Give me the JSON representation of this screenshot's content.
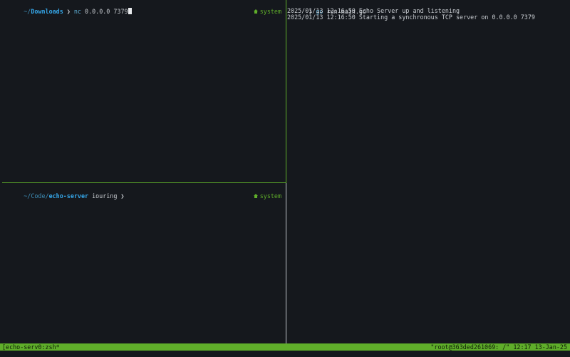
{
  "pane_top_left": {
    "prompt_tilde": "~/",
    "prompt_dir": "Downloads",
    "prompt_arrow": "❯",
    "command": "nc",
    "args": "0.0.0.0 7379",
    "right_tag": "system"
  },
  "pane_bottom_left": {
    "prompt_tilde": "~/Code/",
    "prompt_dir": "echo-server",
    "branch": "iouring",
    "prompt_arrow": "❯",
    "right_tag": "system"
  },
  "pane_right": {
    "prompt_arrow": "❯",
    "command": "go",
    "args": "run main.go",
    "output": [
      "2025/01/13 12:16:50 Echo Server up and listening",
      "2025/01/13 12:16:50 Starting a synchronous TCP server on 0.0.0.0 7379"
    ]
  },
  "statusbar": {
    "session": "[echo-serv0:zsh*",
    "host_info": "\"root@363ded261069: /\" 12:17 13-Jan-25"
  },
  "colors": {
    "accent_green": "#5fae2a",
    "background": "#15181d",
    "dir_blue": "#35a6e8"
  }
}
